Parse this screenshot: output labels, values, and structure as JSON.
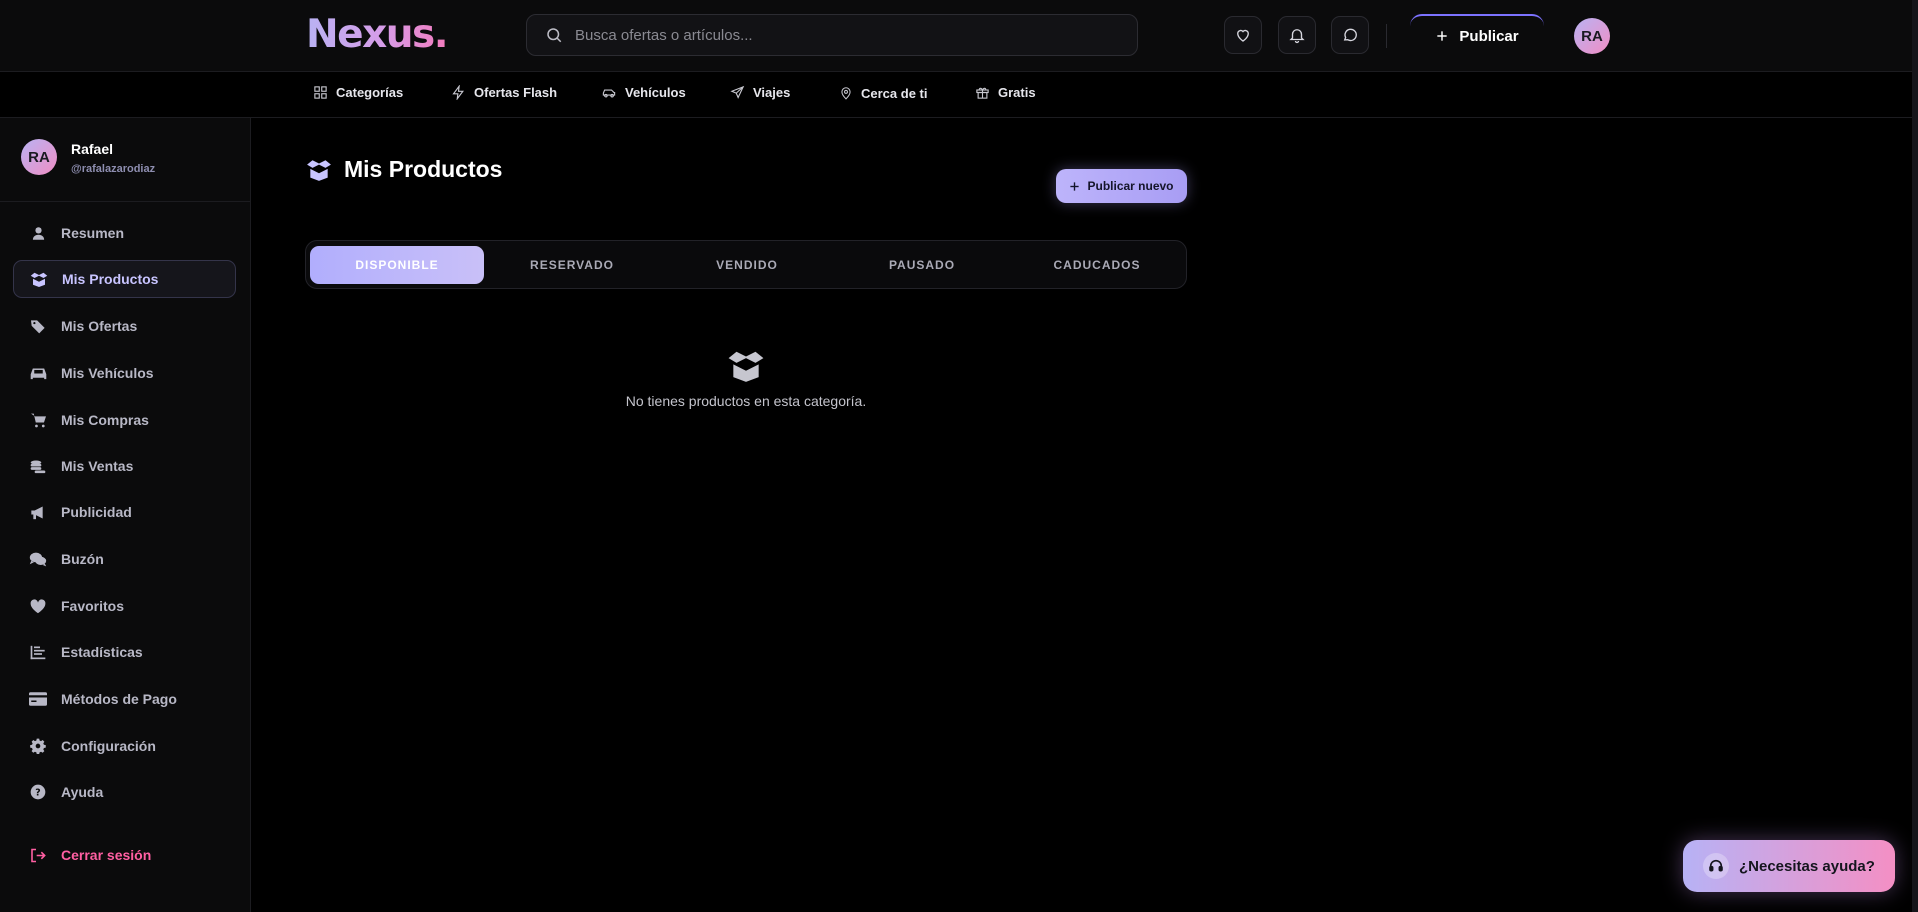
{
  "header": {
    "logo": "Nexus.",
    "search_placeholder": "Busca ofertas o artículos...",
    "publish_label": "Publicar",
    "avatar_initials": "RA"
  },
  "nav": [
    {
      "label": "Categorías",
      "icon": "grid-icon"
    },
    {
      "label": "Ofertas Flash",
      "icon": "bolt-icon"
    },
    {
      "label": "Vehículos",
      "icon": "car-icon"
    },
    {
      "label": "Viajes",
      "icon": "plane-icon"
    },
    {
      "label": "Cerca de ti",
      "icon": "pin-icon"
    },
    {
      "label": "Gratis",
      "icon": "gift-icon"
    }
  ],
  "sidebar": {
    "user": {
      "initials": "RA",
      "name": "Rafael",
      "handle": "@rafalazarodiaz"
    },
    "items": [
      {
        "label": "Resumen",
        "icon": "user-icon"
      },
      {
        "label": "Mis Productos",
        "icon": "box-icon",
        "active": true
      },
      {
        "label": "Mis Ofertas",
        "icon": "tags-icon"
      },
      {
        "label": "Mis Vehículos",
        "icon": "car-icon"
      },
      {
        "label": "Mis Compras",
        "icon": "cart-icon"
      },
      {
        "label": "Mis Ventas",
        "icon": "coins-icon"
      },
      {
        "label": "Publicidad",
        "icon": "megaphone-icon"
      },
      {
        "label": "Buzón",
        "icon": "comments-icon"
      },
      {
        "label": "Favoritos",
        "icon": "heart-icon"
      },
      {
        "label": "Estadísticas",
        "icon": "chart-icon"
      },
      {
        "label": "Métodos de Pago",
        "icon": "card-icon"
      },
      {
        "label": "Configuración",
        "icon": "gear-icon"
      },
      {
        "label": "Ayuda",
        "icon": "question-icon"
      }
    ],
    "logout_label": "Cerrar sesión"
  },
  "main": {
    "title": "Mis Productos",
    "new_button": "Publicar nuevo",
    "tabs": [
      "DISPONIBLE",
      "RESERVADO",
      "VENDIDO",
      "PAUSADO",
      "CADUCADOS"
    ],
    "active_tab": "DISPONIBLE",
    "empty_text": "No tienes productos en esta categoría."
  },
  "help_button": "¿Necesitas ayuda?",
  "colors": {
    "accent": "#b1aefd",
    "pink": "#f48fc4",
    "logout": "#ff5fa2",
    "background": "#000000"
  }
}
